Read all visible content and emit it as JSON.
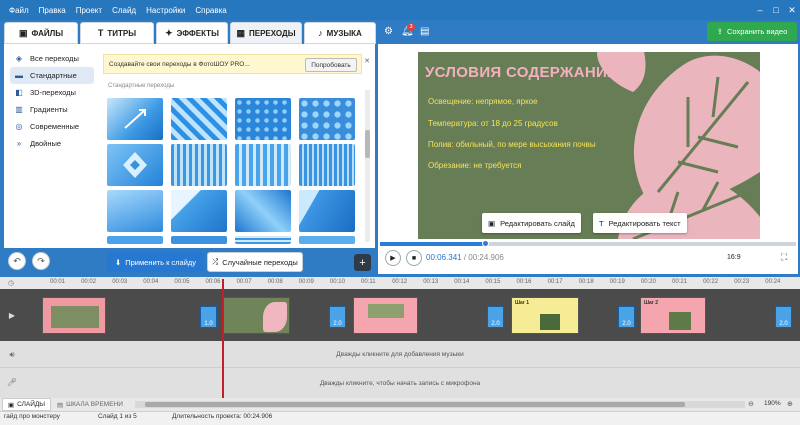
{
  "menu": [
    "Файл",
    "Правка",
    "Проект",
    "Слайд",
    "Настройки",
    "Справка"
  ],
  "window": {
    "minimize": "–",
    "maximize": "□",
    "close": "✕"
  },
  "tabs": [
    {
      "label": "ФАЙЛЫ",
      "icon": "folder-icon"
    },
    {
      "label": "ТИТРЫ",
      "icon": "titles-icon"
    },
    {
      "label": "ЭФФЕКТЫ",
      "icon": "effects-icon"
    },
    {
      "label": "ПЕРЕХОДЫ",
      "icon": "transitions-icon"
    },
    {
      "label": "МУЗЫКА",
      "icon": "music-icon"
    }
  ],
  "notif_count": "3",
  "save_video": "Сохранить видео",
  "categories": [
    "Все переходы",
    "Стандартные",
    "3D-переходы",
    "Градиенты",
    "Современные",
    "Двойные"
  ],
  "promo": {
    "text": "Создавайте свои переходы в ФотоШОУ PRO...",
    "button": "Попробовать",
    "close": "✕"
  },
  "grid_title": "Стандартные переходы",
  "apply_button": "Применить к слайду",
  "random_button": "Случайные переходы",
  "slide": {
    "title": "УСЛОВИЯ СОДЕРЖАНИЯ",
    "lines": [
      "Освещение: непрямое, яркое",
      "Температура: от 18 до 25 градусов",
      "Полив: обильный, по мере высыхания почвы",
      "Обрезание: не требуется"
    ]
  },
  "edit_slide": "Редактировать слайд",
  "edit_text": "Редактировать текст",
  "playback": {
    "current": "00:06.341",
    "separator": " / ",
    "total": "00:24.906",
    "progress": 0.255
  },
  "ratio": "16:9",
  "ticks": [
    "00:01",
    "00:02",
    "00:03",
    "00:04",
    "00:05",
    "00:06",
    "00:07",
    "00:08",
    "00:09",
    "00:10",
    "00:11",
    "00:12",
    "00:13",
    "00:14",
    "00:15",
    "00:16",
    "00:17",
    "00:18",
    "00:19",
    "00:20",
    "00:21",
    "00:22",
    "00:23",
    "00:24"
  ],
  "transitions": [
    "1.0",
    "2.0",
    "2.0",
    "2.0",
    "2.0"
  ],
  "clips": {
    "c1": "Шаг 1",
    "c2": "Шаг 2"
  },
  "music_hint": "Дважды кликните для добавления музыки",
  "mic_hint": "Дважды кликните, чтобы начать запись с микрофона",
  "bottom_tabs": {
    "slides": "СЛАЙДЫ",
    "timeline": "ШКАЛА ВРЕМЕНИ"
  },
  "zoom": "190%",
  "status": {
    "project": "гайд про монстеру",
    "slide": "Слайд 1 из 5",
    "duration": "Длительность проекта: 00:24.906"
  }
}
